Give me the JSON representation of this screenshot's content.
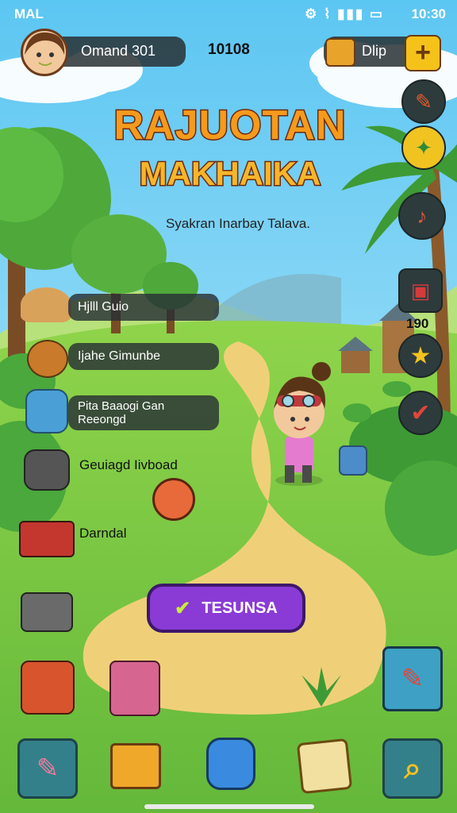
{
  "status": {
    "carrier": "MAL",
    "time": "10:30"
  },
  "header": {
    "player_name": "Omand 301",
    "score": "10108",
    "currency_label": "Dlip"
  },
  "title": {
    "line1": "RAJUOTAN",
    "line2": "MAKHAIKA",
    "subtitle": "Syakran Inarbay Talava."
  },
  "menu": [
    {
      "label": "Hjlll Guio"
    },
    {
      "label": "Ijahe Gimunbe"
    },
    {
      "label": "Pita Baaogi Gan\nReeongd"
    },
    {
      "label": "Geuiagd Iivboad"
    },
    {
      "label": "Darndal"
    }
  ],
  "side": {
    "counter": "190"
  },
  "cta": {
    "label": "TESUNSA"
  },
  "icons": {
    "side": [
      "hammer-icon",
      "compass-icon",
      "trumpet-icon",
      "backpack-icon",
      "star-icon",
      "checkmark-icon"
    ],
    "bottom": [
      "pencil-icon",
      "box-icon",
      "robot-icon",
      "map-icon",
      "magnifier-icon"
    ],
    "right_square": "map-card-icon"
  },
  "colors": {
    "sky_top": "#5cc6f2",
    "sky_bottom": "#c8eefb",
    "grass": "#7ccc42",
    "path": "#efd078",
    "cta": "#8a3bd6"
  }
}
